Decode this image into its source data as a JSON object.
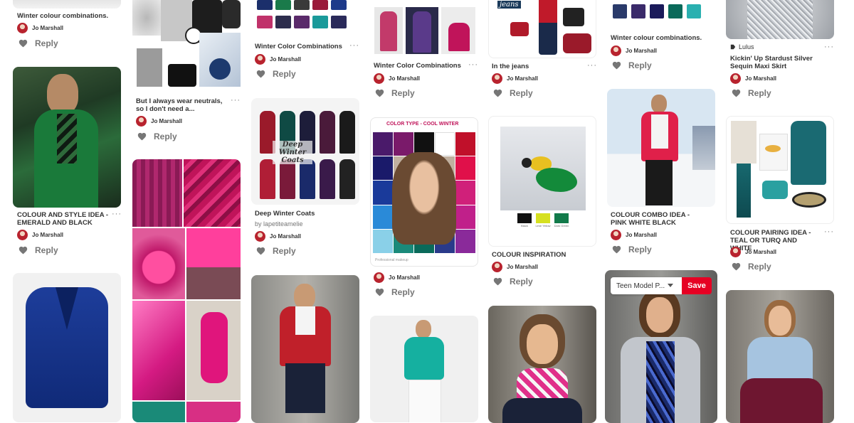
{
  "colors": {
    "save": "#e60023",
    "text": "#333333",
    "muted": "#767676"
  },
  "pins": [
    {
      "title": "Winter colour combinations.",
      "user": "Jo Marshall",
      "reply": "Reply"
    },
    {
      "title": "COLOUR AND STYLE IDEA - EMERALD AND BLACK",
      "user": "Jo Marshall",
      "reply": "Reply"
    },
    {
      "title": "But I always wear neutrals, so I don't need a...",
      "user": "Jo Marshall",
      "reply": "Reply"
    },
    {
      "title": "Winter Color Combinations",
      "user": "Jo Marshall",
      "reply": "Reply"
    },
    {
      "title": "Deep Winter Coats",
      "source": "by lapetiteamelie",
      "user": "Jo Marshall",
      "reply": "Reply"
    },
    {
      "title": "Winter Color Combinations",
      "user": "Jo Marshall",
      "reply": "Reply"
    },
    {
      "title": "",
      "user": "Jo Marshall",
      "reply": "Reply"
    },
    {
      "title": "In the jeans",
      "user": "Jo Marshall",
      "reply": "Reply"
    },
    {
      "title": "COLOUR INSPIRATION",
      "user": "Jo Marshall",
      "reply": "Reply"
    },
    {
      "title": "Winter colour combinations.",
      "user": "Jo Marshall",
      "reply": "Reply"
    },
    {
      "title": "COLOUR COMBO IDEA -PINK WHITE BLACK",
      "user": "Jo Marshall",
      "reply": "Reply"
    },
    {
      "title": "Kickin' Up Stardust Silver Sequin Maxi Skirt",
      "source": "Lulus",
      "user": "Jo Marshall",
      "reply": "Reply"
    },
    {
      "title": "COLOUR PAIRING IDEA - TEAL OR TURQ AND WHITE",
      "user": "Jo Marshall",
      "reply": "Reply"
    }
  ],
  "image_text": {
    "jeans_label": "jeans",
    "coats_label": "Deep Winter Coats",
    "chart_header": "COLOR TYPE - COOL WINTER",
    "chart_footer": "Professional makeup",
    "parrot_swatches": [
      "Black",
      "Lime Yellow",
      "Dark Green"
    ]
  },
  "save_bar": {
    "board": "Teen Model P...",
    "save": "Save"
  },
  "more_label": "···"
}
